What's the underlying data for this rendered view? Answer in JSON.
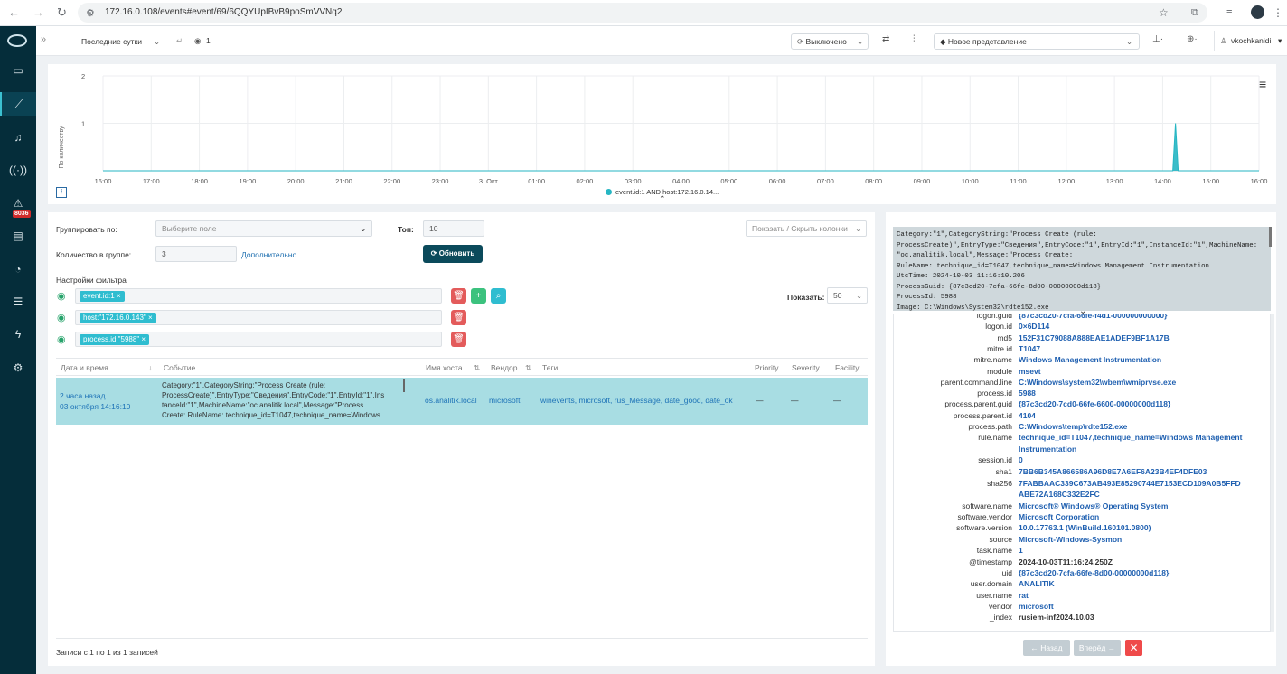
{
  "browser": {
    "url": "172.16.0.108/events#event/69/6QQYUpIBvB9poSmVVNq2",
    "back_icon": "arrow-left-icon",
    "forward_icon": "arrow-right-icon",
    "reload_icon": "reload-icon"
  },
  "sidebar": {
    "alert_badge": "8036",
    "items": [
      "logo-icon",
      "window-icon",
      "chart-icon",
      "bell-icon",
      "radio-icon",
      "warning-icon",
      "document-icon",
      "dashboard-icon",
      "list-icon",
      "bolt-icon",
      "gear-icon"
    ]
  },
  "toolbar": {
    "time_range": "Последние сутки",
    "live_count": "1",
    "refresh_mode": "Выключено",
    "view": "Новое представление",
    "user": "vkochkanidi"
  },
  "chart_data": {
    "type": "line",
    "ylabel": "По количеству",
    "ylim": [
      0,
      2
    ],
    "yticks": [
      "2",
      "1"
    ],
    "categories": [
      "16:00",
      "17:00",
      "18:00",
      "19:00",
      "20:00",
      "21:00",
      "22:00",
      "23:00",
      "3. Окт",
      "01:00",
      "02:00",
      "03:00",
      "04:00",
      "05:00",
      "06:00",
      "07:00",
      "08:00",
      "09:00",
      "10:00",
      "11:00",
      "12:00",
      "13:00",
      "14:00",
      "15:00",
      "16:00"
    ],
    "series": [
      {
        "name": "event.id:1 AND host:172.16.0.14...",
        "color": "#26b6c3",
        "peak_time": "14:16",
        "peak_value": 1
      }
    ]
  },
  "query": {
    "group_by_label": "Группировать по:",
    "group_by_placeholder": "Выберите поле",
    "top_label": "Топ:",
    "top_value": "10",
    "group_count_label": "Количество в группе:",
    "group_count_value": "3",
    "advanced_link": "Дополнительно",
    "refresh_button": "Обновить",
    "columns_toggle": "Показать / Скрыть колонки",
    "filter_settings_label": "Настройки фильтра",
    "filters": [
      "event.id:1",
      "host:\"172.16.0.143\"",
      "process.id:\"5988\""
    ],
    "show_label": "Показать:",
    "show_value": "50"
  },
  "table": {
    "headers": [
      "Дата и время",
      "Событие",
      "Имя хоста",
      "Вендор",
      "Теги",
      "Priority",
      "Severity",
      "Facility"
    ],
    "rows": [
      {
        "time_relative": "2 часа назад",
        "time_abs": "03 октября 14:16:10",
        "event_lines": [
          "Category:\"1\",CategoryString:\"Process Create (rule:",
          "ProcessCreate)\",EntryType:\"Сведения\",EntryCode:\"1\",EntryId:\"1\",Ins",
          "tanceId:\"1\",MachineName:\"oc.analitik.local\",Message:\"Process",
          "Create: RuleName: technique_id=T1047,technique_name=Windows"
        ],
        "host": "os.analitik.local",
        "vendor": "microsoft",
        "tags": "winevents, microsoft, rus_Message, date_good, date_ok",
        "priority": "—",
        "severity": "—",
        "facility": "—"
      }
    ],
    "footer": "Записи с 1 по 1 из 1 записей"
  },
  "detail": {
    "raw_lines": [
      "Category:\"1\",CategoryString:\"Process Create (rule:",
      "ProcessCreate)\",EntryType:\"Сведения\",EntryCode:\"1\",EntryId:\"1\",InstanceId:\"1\",MachineName:",
      "\"oc.analitik.local\",Message:\"Process Create:",
      "RuleName: technique_id=T1047,technique_name=Windows Management Instrumentation",
      "UtcTime: 2024-10-03 11:16:10.206",
      "ProcessGuid: {87c3cd20-7cfa-66fe-8d00-00000000d118}",
      "ProcessId: 5988",
      "Image: C:\\Windows\\System32\\rdte152.exe"
    ],
    "fields": [
      {
        "k": "logon.guid",
        "v": "{87c3cd20-7cfa-66fe-f4d1-000000000000}"
      },
      {
        "k": "logon.id",
        "v": "0×6D114"
      },
      {
        "k": "md5",
        "v": "152F31C79088A888EAE1ADEF9BF1A17B"
      },
      {
        "k": "mitre.id",
        "v": "T1047"
      },
      {
        "k": "mitre.name",
        "v": "Windows Management Instrumentation"
      },
      {
        "k": "module",
        "v": "msevt"
      },
      {
        "k": "parent.command.line",
        "v": "C:\\Windows\\system32\\wbem\\wmiprvse.exe"
      },
      {
        "k": "process.id",
        "v": "5988"
      },
      {
        "k": "process.parent.guid",
        "v": "{87c3cd20-7cd0-66fe-6600-00000000d118}"
      },
      {
        "k": "process.parent.id",
        "v": "4104"
      },
      {
        "k": "process.path",
        "v": "C:\\Windows\\temp\\rdte152.exe"
      },
      {
        "k": "rule.name",
        "v": "technique_id=T1047,technique_name=Windows Management",
        "v2": "Instrumentation"
      },
      {
        "k": "session.id",
        "v": "0"
      },
      {
        "k": "sha1",
        "v": "7BB6B345A866586A96D8E7A6EF6A23B4EF4DFE03"
      },
      {
        "k": "sha256",
        "v": "7FABBAAC339C673AB493E85290744E7153ECD109A0B5FFD",
        "v2": "ABE72A168C332E2FC"
      },
      {
        "k": "software.name",
        "v": "Microsoft® Windows® Operating System"
      },
      {
        "k": "software.vendor",
        "v": "Microsoft Corporation"
      },
      {
        "k": "software.version",
        "v": "10.0.17763.1 (WinBuild.160101.0800)"
      },
      {
        "k": "source",
        "v": "Microsoft-Windows-Sysmon"
      },
      {
        "k": "task.name",
        "v": "1"
      },
      {
        "k": "@timestamp",
        "v": "2024-10-03T11:16:24.250Z",
        "plain": true
      },
      {
        "k": "uid",
        "v": "{87c3cd20-7cfa-66fe-8d00-00000000d118}"
      },
      {
        "k": "user.domain",
        "v": "ANALITIK"
      },
      {
        "k": "user.name",
        "v": "rat"
      },
      {
        "k": "vendor",
        "v": "microsoft"
      },
      {
        "k": "_index",
        "v": "rusiem-inf2024.10.03",
        "plain": true
      }
    ],
    "prev_button": "← Назад",
    "next_button": "Вперёд →"
  }
}
